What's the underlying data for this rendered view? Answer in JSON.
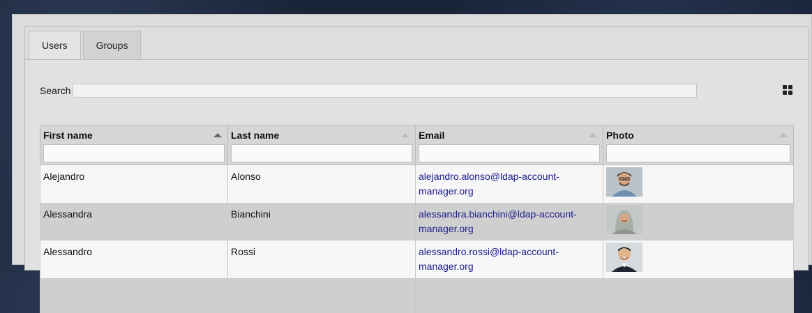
{
  "tabs": [
    {
      "label": "Users"
    },
    {
      "label": "Groups"
    }
  ],
  "search": {
    "label": "Search",
    "value": ""
  },
  "view_toggle_icon": "grid-view-icon",
  "columns": [
    {
      "label": "First name",
      "sorted": true
    },
    {
      "label": "Last name",
      "sorted": false
    },
    {
      "label": "Email",
      "sorted": false
    },
    {
      "label": "Photo",
      "sorted": false
    }
  ],
  "rows": [
    {
      "first": "Alejandro",
      "last": "Alonso",
      "email": "alejandro.alonso@ldap-account-manager.org",
      "email_line1": "alejandro.alonso@ldap-account-",
      "email_line2": "manager.org",
      "photo": "man with glasses and beard"
    },
    {
      "first": "Alessandra",
      "last": "Bianchini",
      "email": "alessandra.bianchini@ldap-account-manager.org",
      "email_line1": "alessandra.bianchini@ldap-account-",
      "email_line2": "manager.org",
      "photo": "woman with headscarf"
    },
    {
      "first": "Alessandro",
      "last": "Rossi",
      "email": "alessandro.rossi@ldap-account-manager.org",
      "email_line1": "alessandro.rossi@ldap-account-",
      "email_line2": "manager.org",
      "photo": "smiling man"
    }
  ]
}
